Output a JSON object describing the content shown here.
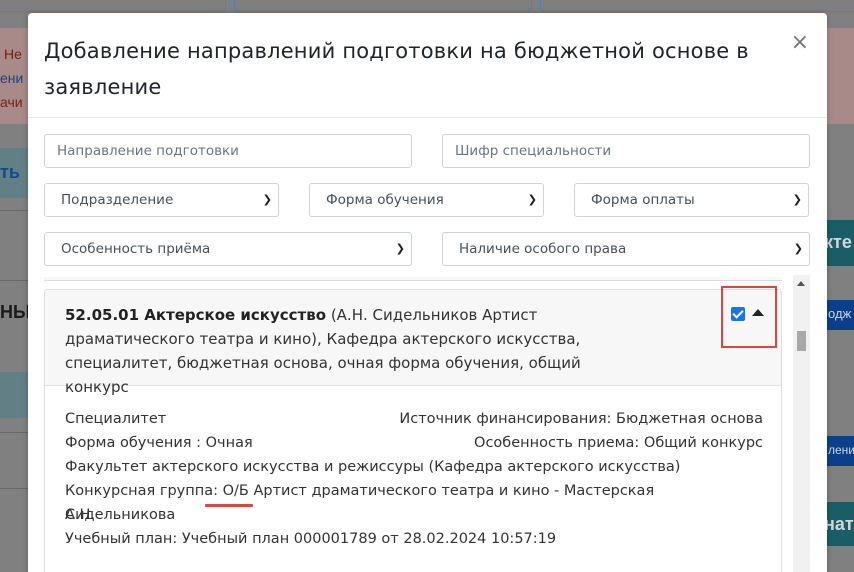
{
  "background": {
    "alert_line1": "Не",
    "alert_line2": "ени",
    "alert_line3": "ачи",
    "left_label_1": "ть",
    "left_label_2": "НЫ",
    "right_label_1": "кте",
    "right_label_2": "одж",
    "right_label_3": "ления",
    "right_label_4": "ната"
  },
  "modal": {
    "title": "Добавление направлений подготовки на бюджетной основе в заявление",
    "close_label": "×"
  },
  "filters": {
    "direction_placeholder": "Направление подготовки",
    "code_placeholder": "Шифр специальности",
    "subdivision": "Подразделение",
    "study_form": "Форма обучения",
    "payment_form": "Форма оплаты",
    "admission_feature": "Особенность приёма",
    "special_right": "Наличие особого права"
  },
  "program": {
    "code_name": "52.05.01 Актерское искусство",
    "details": " (А.Н. Сидельников Артист драматического театра и кино), Кафедра актерского искусства, специалитет, бюджетная основа, очная форма обучения, общий конкурс",
    "checked": true,
    "level": "Специалитет",
    "financing": "Источник финансирования: Бюджетная основа",
    "study_form": "Форма обучения : Очная",
    "admission_feature": "Особенность приема: Общий конкурс",
    "faculty": "Факультет актерского искусства и режиссуры (Кафедра актерского искусства)",
    "competition_group": "Конкурсная группа: О/Б Артист драматического театра и кино - Мастерская Сидельникова А.Н.",
    "competition_group_line1": "Конкурсная группа: О/Б Артист драматического театра и кино - Мастерская Сидельникова",
    "competition_group_line2": "А.Н.",
    "study_plan": "Учебный план: Учебный план 000001789 от 28.02.2024 10:57:19"
  },
  "colors": {
    "accent": "#1a73e8",
    "highlight": "#d9473d"
  }
}
